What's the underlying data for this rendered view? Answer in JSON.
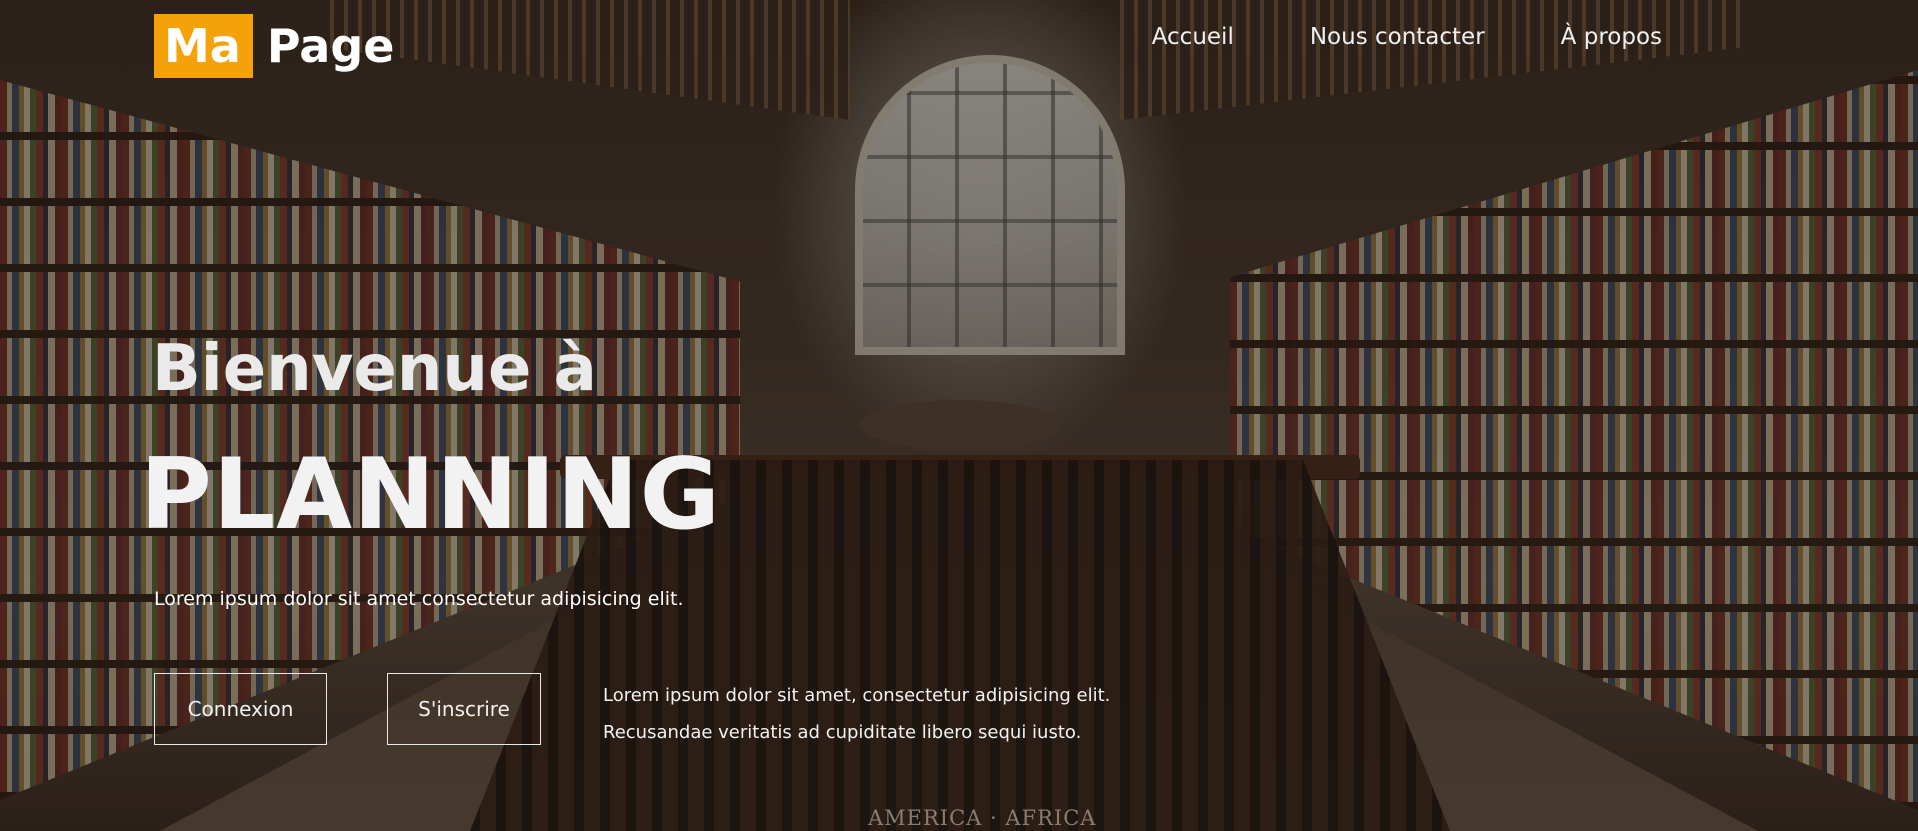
{
  "logo": {
    "box_text": "Ma",
    "text": "Page",
    "accent": "#f5a20a"
  },
  "nav": {
    "items": [
      "Accueil",
      "Nous contacter",
      "À propos"
    ]
  },
  "hero": {
    "welcome": "Bienvenue à",
    "title": "PLANNING",
    "subtitle": "Lorem ipsum dolor sit amet consectetur adipisicing elit.",
    "login_label": "Connexion",
    "signup_label": "S'inscrire",
    "side_line1": "Lorem ipsum dolor sit amet, consectetur adipisicing elit.",
    "side_line2": "Recusandae veritatis ad cupiditate libero sequi iusto."
  },
  "background": {
    "caption": "AMERICA · AFRICA"
  }
}
